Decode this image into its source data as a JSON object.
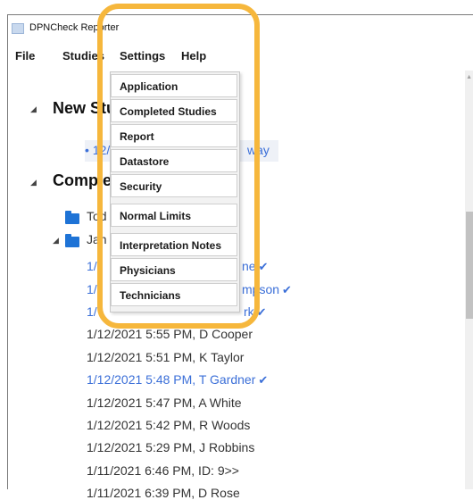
{
  "app": {
    "title": "DPNCheck Reporter"
  },
  "menubar": {
    "file": "File",
    "studies": "Studies",
    "settings": "Settings",
    "help": "Help"
  },
  "settings_menu": {
    "items": [
      "Application",
      "Completed Studies",
      "Report",
      "Datastore",
      "Security",
      "Normal Limits",
      "Interpretation Notes",
      "Physicians",
      "Technicians"
    ]
  },
  "tree": {
    "new_studies": {
      "title": "New Stu",
      "item": "• 12/",
      "item_tail": "way"
    },
    "completed": {
      "title": "Comple",
      "today_folder": "Tod",
      "jan_folder": "Jan",
      "check_glyph": "✔",
      "studies": [
        {
          "pre": "1/",
          "post": "ne",
          "checked": true
        },
        {
          "pre": "1/",
          "post": "mpson",
          "checked": true
        },
        {
          "pre": "1/",
          "post": "rk",
          "checked": true
        },
        {
          "text": "1/12/2021 5:55 PM, D Cooper",
          "checked": false
        },
        {
          "text": "1/12/2021 5:51 PM, K Taylor",
          "checked": false
        },
        {
          "text": "1/12/2021 5:48 PM, T Gardner",
          "checked": true
        },
        {
          "text": "1/12/2021 5:47 PM, A White",
          "checked": false
        },
        {
          "text": "1/12/2021 5:42 PM, R Woods",
          "checked": false
        },
        {
          "text": "1/12/2021 5:29 PM, J Robbins",
          "checked": false
        },
        {
          "text": "1/11/2021 6:46 PM, ID: 9>>",
          "checked": false
        },
        {
          "text": "1/11/2021 6:39 PM, D Rose",
          "checked": false
        }
      ]
    }
  },
  "colors": {
    "link": "#3b6fd8",
    "highlight": "#f6b73c",
    "folder": "#1e73d6"
  }
}
